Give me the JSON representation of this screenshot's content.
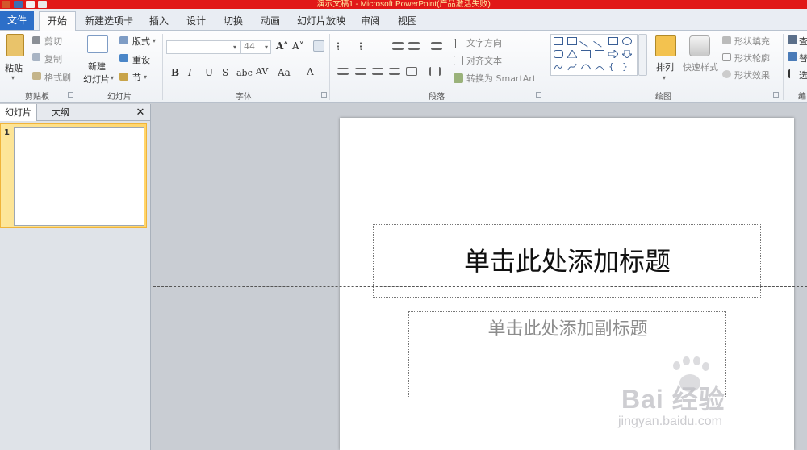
{
  "window": {
    "title": "演示文稿1 - Microsoft PowerPoint(产品激活失败)"
  },
  "colors": {
    "title_bar": "#e11818",
    "file_tab": "#2d6fc8",
    "selected_thumb": "#ffd56b"
  },
  "tabs": [
    {
      "label": "文件",
      "icon": "file-tab"
    },
    {
      "label": "开始",
      "selected": true
    },
    {
      "label": "新建选项卡"
    },
    {
      "label": "插入"
    },
    {
      "label": "设计"
    },
    {
      "label": "切换"
    },
    {
      "label": "动画"
    },
    {
      "label": "幻灯片放映"
    },
    {
      "label": "审阅"
    },
    {
      "label": "视图"
    }
  ],
  "ribbon": {
    "clipboard": {
      "paste": "粘贴",
      "cut": "剪切",
      "copy": "复制",
      "format_painter": "格式刷",
      "group": "剪贴板"
    },
    "slides": {
      "new_slide_1": "新建",
      "new_slide_2": "幻灯片",
      "layout": "版式",
      "reset": "重设",
      "section": "节",
      "group": "幻灯片"
    },
    "font": {
      "size": "44",
      "bold": "B",
      "italic": "I",
      "underline": "U",
      "shadow": "S",
      "strike": "abc",
      "group": "字体"
    },
    "paragraph": {
      "text_direction": "文字方向",
      "align_text": "对齐文本",
      "convert_smartart": "转换为 SmartArt",
      "group": "段落"
    },
    "drawing": {
      "arrange": "排列",
      "quick_styles": "快速样式",
      "shape_fill": "形状填充",
      "shape_outline": "形状轮廓",
      "shape_effects": "形状效果",
      "group": "绘图"
    },
    "editing": {
      "find": "查",
      "replace": "替",
      "select": "选",
      "group": "编"
    }
  },
  "panel": {
    "tab_slides": "幻灯片",
    "tab_outline": "大纲",
    "close": "✕",
    "slide_number": "1"
  },
  "slide": {
    "title_placeholder": "单击此处添加标题",
    "subtitle_placeholder": "单击此处添加副标题"
  },
  "watermark": {
    "logo": "Bai 经验",
    "url": "jingyan.baidu.com"
  }
}
